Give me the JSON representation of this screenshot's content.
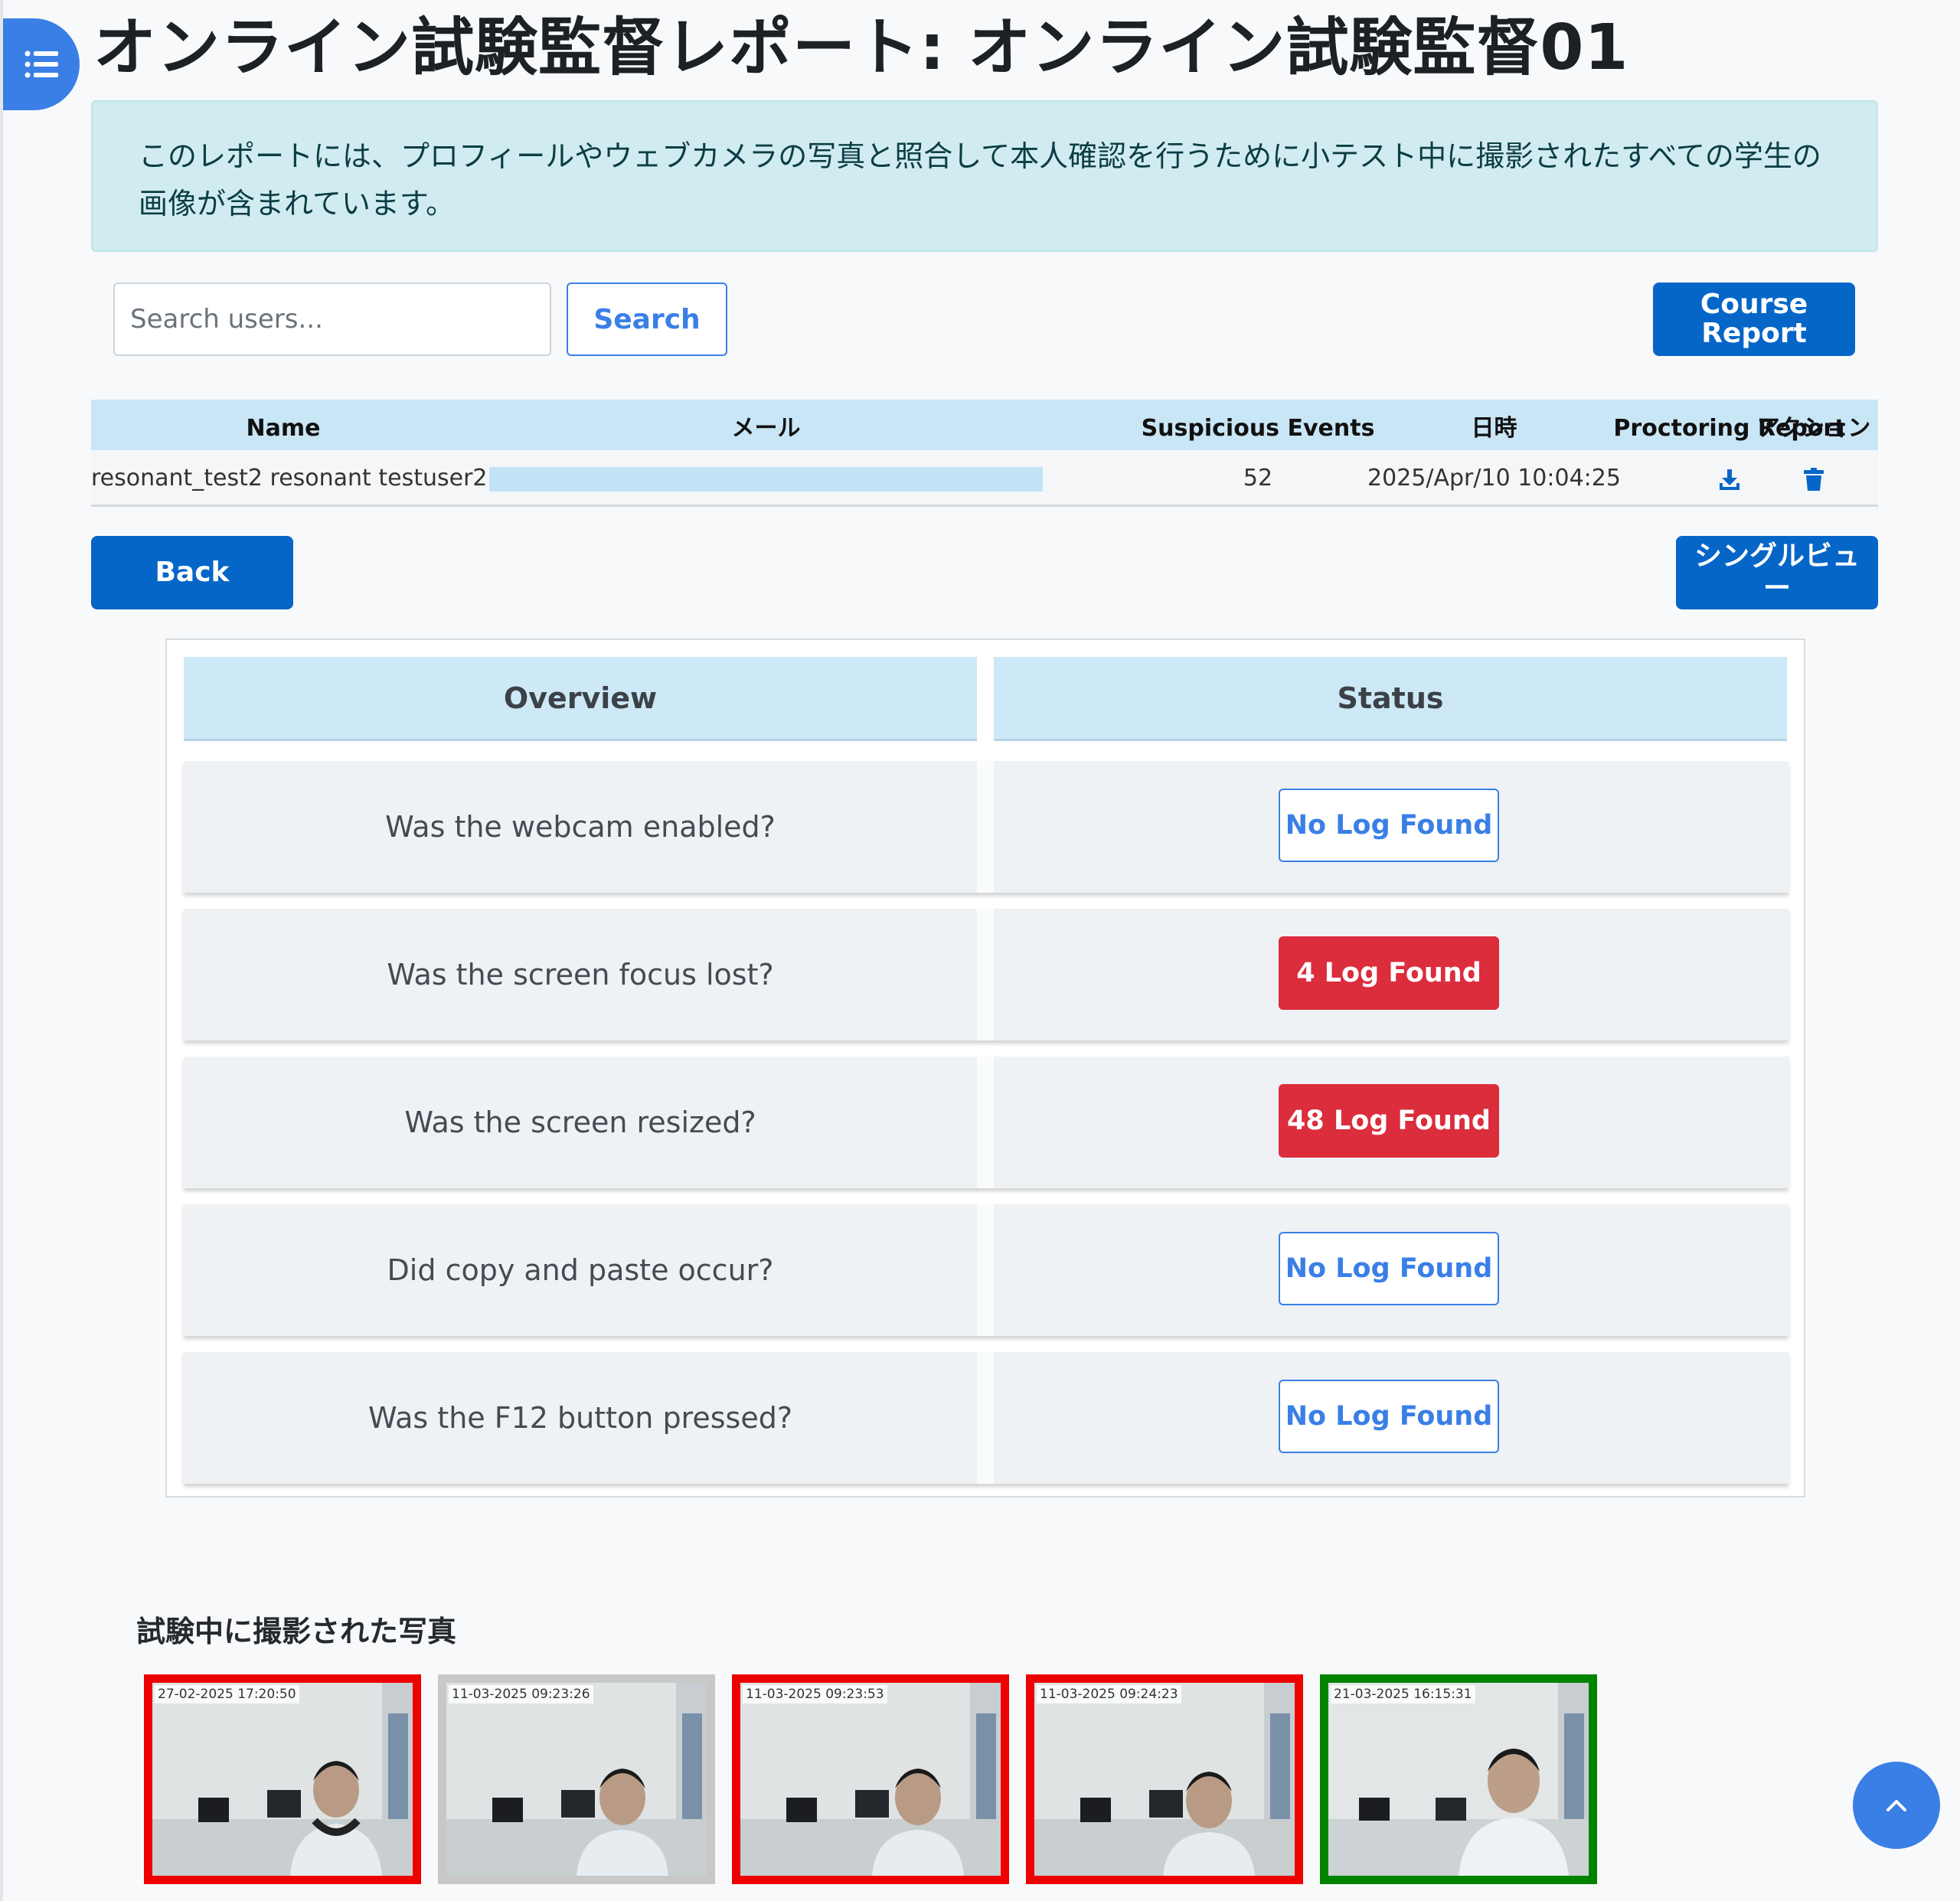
{
  "page": {
    "title": "オンライン試験監督レポート: オンライン試験監督01",
    "info": "このレポートには、プロフィールやウェブカメラの写真と照合して本人確認を行うために小テスト中に撮影されたすべての学生の画像が含まれています。"
  },
  "search": {
    "placeholder": "Search users...",
    "button": "Search"
  },
  "buttons": {
    "course_report": "Course Report",
    "back": "Back",
    "single_view": "シングルビュー"
  },
  "table": {
    "headers": [
      "Name",
      "メール",
      "Suspicious Events",
      "日時",
      "Proctoring Report",
      "アクション"
    ],
    "row": {
      "name": "resonant_test2 resonant testuser2",
      "suspicious_events": "52",
      "datetime": "2025/Apr/10 10:04:25",
      "report_icon": "download-icon",
      "action_icon": "trash-icon"
    }
  },
  "overview": {
    "headers": {
      "overview": "Overview",
      "status": "Status"
    },
    "rows": [
      {
        "question": "Was the webcam enabled?",
        "status": "No Log Found",
        "flagged": false
      },
      {
        "question": "Was the screen focus lost?",
        "status": "4 Log Found",
        "flagged": true
      },
      {
        "question": "Was the screen resized?",
        "status": "48 Log Found",
        "flagged": true
      },
      {
        "question": "Did copy and paste occur?",
        "status": "No Log Found",
        "flagged": false
      },
      {
        "question": "Was the F12 button pressed?",
        "status": "No Log Found",
        "flagged": false
      }
    ]
  },
  "photos": {
    "title": "試験中に撮影された写真",
    "items": [
      {
        "timestamp": "27-02-2025 17:20:50",
        "frame": "red"
      },
      {
        "timestamp": "11-03-2025 09:23:26",
        "frame": "gray"
      },
      {
        "timestamp": "11-03-2025 09:23:53",
        "frame": "red"
      },
      {
        "timestamp": "11-03-2025 09:24:23",
        "frame": "red"
      },
      {
        "timestamp": "21-03-2025 16:15:31",
        "frame": "green"
      }
    ]
  },
  "colors": {
    "primary": "#0566c8",
    "accent": "#3a7fe6",
    "danger": "#dc2d3d",
    "info_bg": "#d1ecf1",
    "table_head": "#c9e6f7"
  }
}
